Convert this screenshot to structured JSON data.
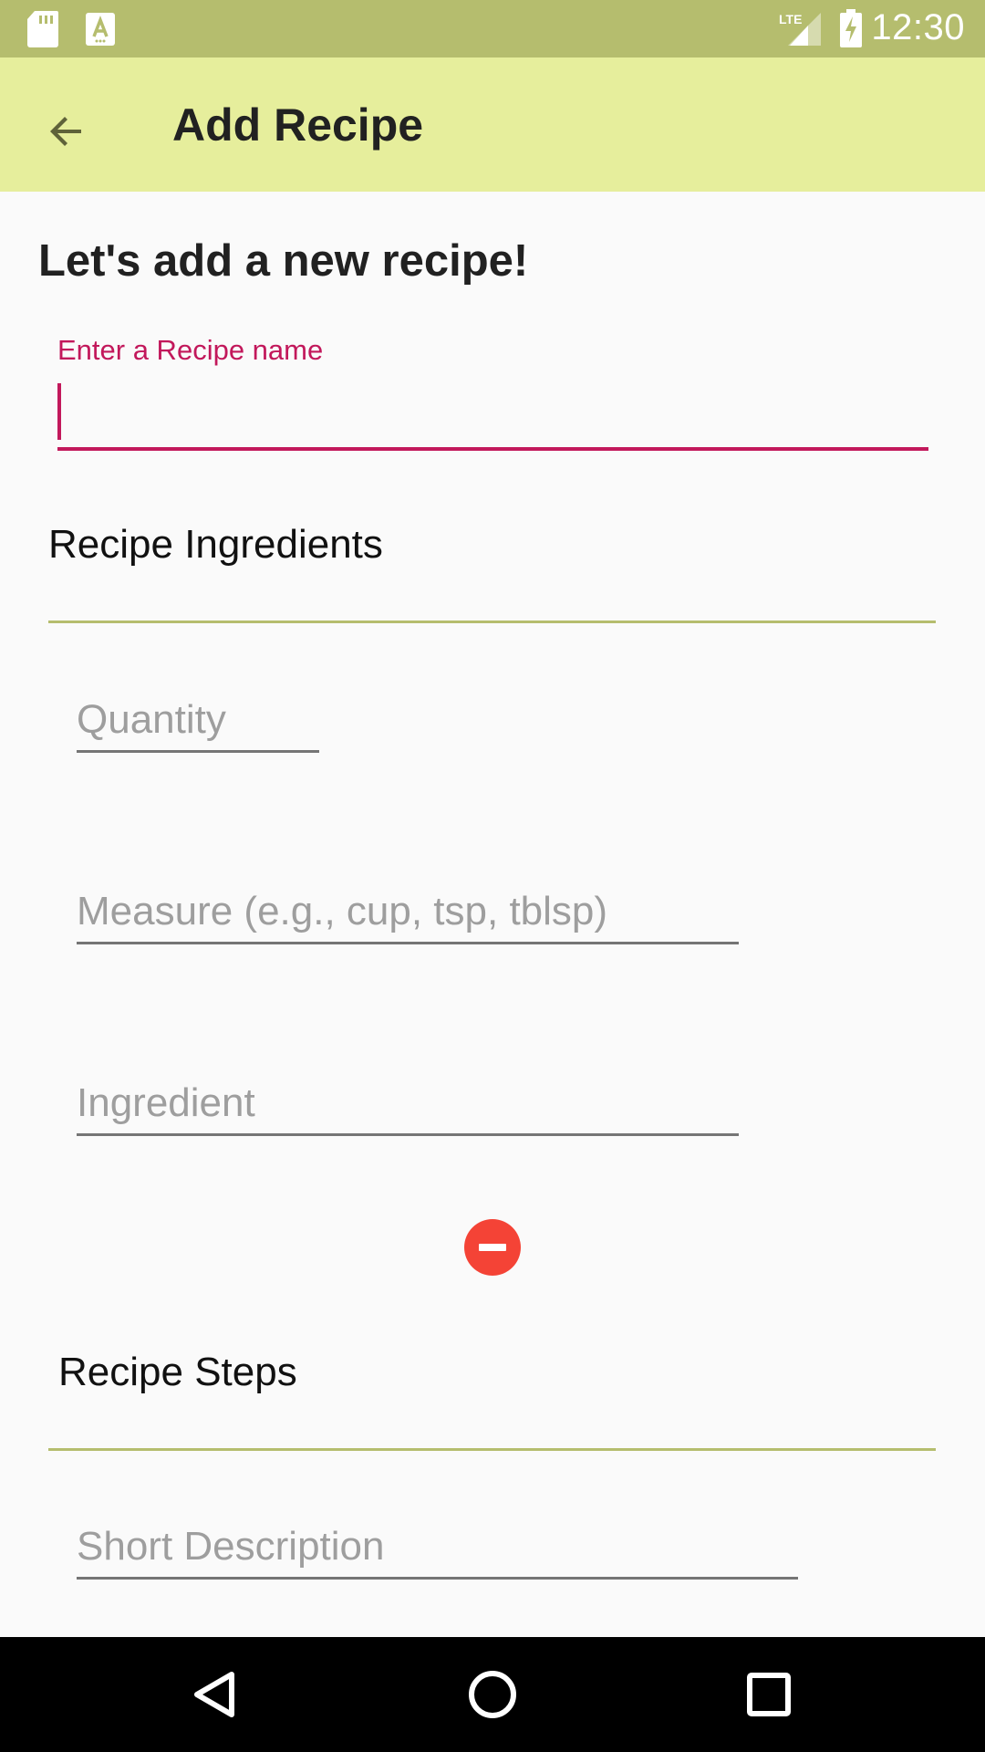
{
  "status_bar": {
    "time": "12:30",
    "network": "LTE",
    "icons": [
      "sd-card-icon",
      "font-a-icon",
      "lte-signal-icon",
      "battery-charging-icon"
    ],
    "background": "#b5bd6e"
  },
  "app_bar": {
    "title": "Add Recipe",
    "back_icon": "arrow-back-icon",
    "background": "#e6ee9c"
  },
  "content": {
    "heading": "Let's add a new recipe!",
    "recipe_name": {
      "label": "Enter a Recipe name",
      "value": "",
      "accent": "#c2185b"
    },
    "ingredients": {
      "title": "Recipe Ingredients",
      "fields": {
        "quantity_placeholder": "Quantity",
        "measure_placeholder": "Measure (e.g., cup, tsp, tblsp)",
        "ingredient_placeholder": "Ingredient"
      },
      "remove_icon": "remove-circle-icon",
      "remove_color": "#f44336"
    },
    "steps": {
      "title": "Recipe Steps",
      "short_description_placeholder": "Short Description"
    }
  },
  "nav_bar": {
    "icons": [
      "back-triangle-icon",
      "home-circle-icon",
      "recents-square-icon"
    ]
  }
}
